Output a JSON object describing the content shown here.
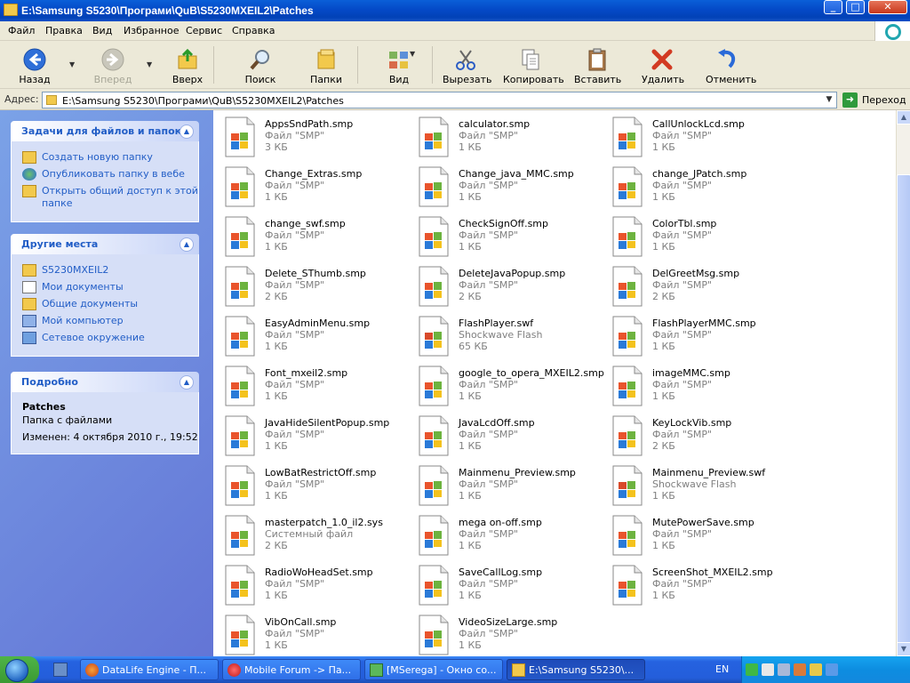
{
  "window": {
    "title": "E:\\Samsung S5230\\Програми\\QuB\\S5230MXEIL2\\Patches"
  },
  "menu": [
    "Файл",
    "Правка",
    "Вид",
    "Избранное",
    "Сервис",
    "Справка"
  ],
  "toolbar": {
    "back": "Назад",
    "forward": "Вперед",
    "up": "Вверх",
    "search": "Поиск",
    "folders": "Папки",
    "view": "Вид",
    "cut": "Вырезать",
    "copy": "Копировать",
    "paste": "Вставить",
    "delete": "Удалить",
    "undo": "Отменить"
  },
  "address": {
    "label": "Адрес:",
    "value": "E:\\Samsung S5230\\Програми\\QuB\\S5230MXEIL2\\Patches",
    "go": "Переход"
  },
  "left_panel": {
    "tasks": {
      "title": "Задачи для файлов и папок",
      "items": [
        "Создать новую папку",
        "Опубликовать папку в вебе",
        "Открыть общий доступ к этой папке"
      ]
    },
    "places": {
      "title": "Другие места",
      "items": [
        "S5230MXEIL2",
        "Мои документы",
        "Общие документы",
        "Мой компьютер",
        "Сетевое окружение"
      ]
    },
    "details": {
      "title": "Подробно",
      "name": "Patches",
      "type": "Папка с файлами",
      "modified": "Изменен: 4 октября 2010 г., 19:52"
    }
  },
  "files": [
    {
      "name": "AppsSndPath.smp",
      "type": "Файл \"SMP\"",
      "size": "3 КБ"
    },
    {
      "name": "calculator.smp",
      "type": "Файл \"SMP\"",
      "size": "1 КБ"
    },
    {
      "name": "CallUnlockLcd.smp",
      "type": "Файл \"SMP\"",
      "size": "1 КБ"
    },
    {
      "name": "Change_Extras.smp",
      "type": "Файл \"SMP\"",
      "size": "1 КБ"
    },
    {
      "name": "Change_java_MMC.smp",
      "type": "Файл \"SMP\"",
      "size": "1 КБ"
    },
    {
      "name": "change_JPatch.smp",
      "type": "Файл \"SMP\"",
      "size": "1 КБ"
    },
    {
      "name": "change_swf.smp",
      "type": "Файл \"SMP\"",
      "size": "1 КБ"
    },
    {
      "name": "CheckSignOff.smp",
      "type": "Файл \"SMP\"",
      "size": "1 КБ"
    },
    {
      "name": "ColorTbl.smp",
      "type": "Файл \"SMP\"",
      "size": "1 КБ"
    },
    {
      "name": "Delete_SThumb.smp",
      "type": "Файл \"SMP\"",
      "size": "2 КБ"
    },
    {
      "name": "DeleteJavaPopup.smp",
      "type": "Файл \"SMP\"",
      "size": "2 КБ"
    },
    {
      "name": "DelGreetMsg.smp",
      "type": "Файл \"SMP\"",
      "size": "2 КБ"
    },
    {
      "name": "EasyAdminMenu.smp",
      "type": "Файл \"SMP\"",
      "size": "1 КБ"
    },
    {
      "name": "FlashPlayer.swf",
      "type": "Shockwave Flash",
      "size": "65 КБ"
    },
    {
      "name": "FlashPlayerMMC.smp",
      "type": "Файл \"SMP\"",
      "size": "1 КБ"
    },
    {
      "name": "Font_mxeil2.smp",
      "type": "Файл \"SMP\"",
      "size": "1 КБ"
    },
    {
      "name": "google_to_opera_MXEIL2.smp",
      "type": "Файл \"SMP\"",
      "size": "1 КБ"
    },
    {
      "name": "imageMMC.smp",
      "type": "Файл \"SMP\"",
      "size": "1 КБ"
    },
    {
      "name": "JavaHideSilentPopup.smp",
      "type": "Файл \"SMP\"",
      "size": "1 КБ"
    },
    {
      "name": "JavaLcdOff.smp",
      "type": "Файл \"SMP\"",
      "size": "1 КБ"
    },
    {
      "name": "KeyLockVib.smp",
      "type": "Файл \"SMP\"",
      "size": "2 КБ"
    },
    {
      "name": "LowBatRestrictOff.smp",
      "type": "Файл \"SMP\"",
      "size": "1 КБ"
    },
    {
      "name": "Mainmenu_Preview.smp",
      "type": "Файл \"SMP\"",
      "size": "1 КБ"
    },
    {
      "name": "Mainmenu_Preview.swf",
      "type": "Shockwave Flash",
      "size": "1 КБ"
    },
    {
      "name": "masterpatch_1.0_il2.sys",
      "type": "Системный файл",
      "size": "2 КБ"
    },
    {
      "name": "mega on-off.smp",
      "type": "Файл \"SMP\"",
      "size": "1 КБ"
    },
    {
      "name": "MutePowerSave.smp",
      "type": "Файл \"SMP\"",
      "size": "1 КБ"
    },
    {
      "name": "RadioWoHeadSet.smp",
      "type": "Файл \"SMP\"",
      "size": "1 КБ"
    },
    {
      "name": "SaveCallLog.smp",
      "type": "Файл \"SMP\"",
      "size": "1 КБ"
    },
    {
      "name": "ScreenShot_MXEIL2.smp",
      "type": "Файл \"SMP\"",
      "size": "1 КБ"
    },
    {
      "name": "VibOnCall.smp",
      "type": "Файл \"SMP\"",
      "size": "1 КБ"
    },
    {
      "name": "VideoSizeLarge.smp",
      "type": "Файл \"SMP\"",
      "size": "1 КБ"
    }
  ],
  "taskbar": {
    "buttons": [
      "DataLife Engine - П...",
      "Mobile Forum -> Па...",
      "[MSerega] - Окно со...",
      "E:\\Samsung S5230\\..."
    ],
    "lang": "EN"
  }
}
